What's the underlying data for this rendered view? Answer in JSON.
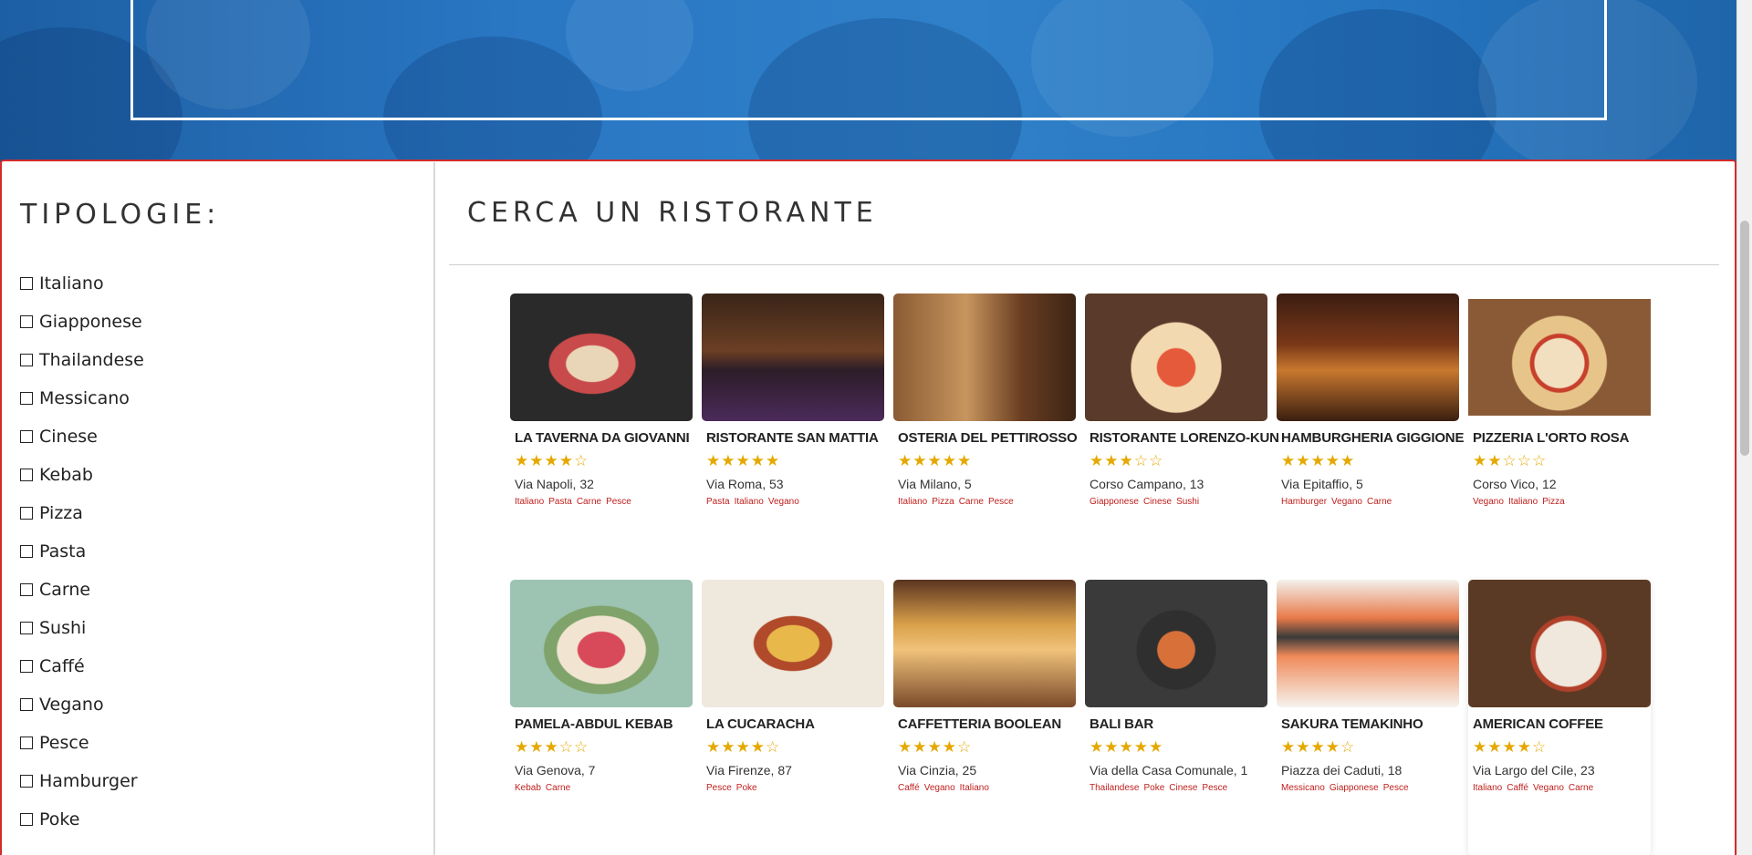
{
  "sidebar": {
    "title": "TIPOLOGIE:",
    "categories": [
      "Italiano",
      "Giapponese",
      "Thailandese",
      "Messicano",
      "Cinese",
      "Kebab",
      "Pizza",
      "Pasta",
      "Carne",
      "Sushi",
      "Caffé",
      "Vegano",
      "Pesce",
      "Hamburger",
      "Poke"
    ]
  },
  "main": {
    "title": "CERCA UN RISTORANTE"
  },
  "colors": {
    "accent_red": "#c0201d",
    "star": "#e5a800",
    "hero_blue": "#2a77c4"
  },
  "restaurants": [
    {
      "name": "LA TAVERNA DA GIOVANNI",
      "rating": 4,
      "address": "Via Napoli, 32",
      "tags": [
        "Italiano",
        "Pasta",
        "Carne",
        "Pesce"
      ]
    },
    {
      "name": "RISTORANTE SAN MATTIA",
      "rating": 5,
      "address": "Via Roma, 53",
      "tags": [
        "Pasta",
        "Italiano",
        "Vegano"
      ]
    },
    {
      "name": "OSTERIA DEL PETTIROSSO",
      "rating": 5,
      "address": "Via Milano, 5",
      "tags": [
        "Italiano",
        "Pizza",
        "Carne",
        "Pesce"
      ]
    },
    {
      "name": "RISTORANTE LORENZO-KUN",
      "rating": 3,
      "address": "Corso Campano, 13",
      "tags": [
        "Giapponese",
        "Cinese",
        "Sushi"
      ]
    },
    {
      "name": "HAMBURGHERIA GIGGIONE",
      "rating": 5,
      "address": "Via Epitaffio, 5",
      "tags": [
        "Hamburger",
        "Vegano",
        "Carne"
      ]
    },
    {
      "name": "PIZZERIA L'ORTO ROSA",
      "rating": 2,
      "address": "Corso Vico, 12",
      "tags": [
        "Vegano",
        "Italiano",
        "Pizza"
      ]
    },
    {
      "name": "PAMELA-ABDUL KEBAB",
      "rating": 3,
      "address": "Via Genova, 7",
      "tags": [
        "Kebab",
        "Carne"
      ]
    },
    {
      "name": "LA CUCARACHA",
      "rating": 4,
      "address": "Via Firenze, 87",
      "tags": [
        "Pesce",
        "Poke"
      ]
    },
    {
      "name": "CAFFETTERIA BOOLEAN",
      "rating": 4,
      "address": "Via Cinzia, 25",
      "tags": [
        "Caffé",
        "Vegano",
        "Italiano"
      ]
    },
    {
      "name": "BALI BAR",
      "rating": 5,
      "address": "Via della Casa Comunale, 1",
      "tags": [
        "Thailandese",
        "Poke",
        "Cinese",
        "Pesce"
      ]
    },
    {
      "name": "SAKURA TEMAKINHO",
      "rating": 4,
      "address": "Piazza dei Caduti, 18",
      "tags": [
        "Messicano",
        "Giapponese",
        "Pesce"
      ]
    },
    {
      "name": "AMERICAN COFFEE",
      "rating": 4,
      "address": "Via Largo del Cile, 23",
      "tags": [
        "Italiano",
        "Caffé",
        "Vegano",
        "Carne"
      ]
    }
  ]
}
